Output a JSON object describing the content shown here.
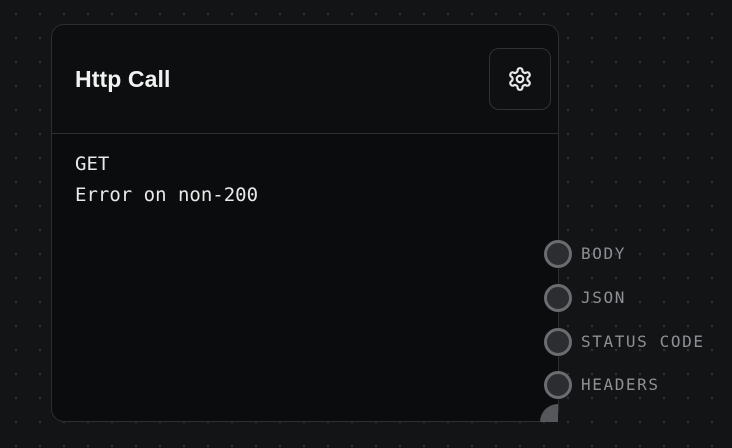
{
  "node": {
    "title": "Http Call",
    "settings_icon": "gear-icon",
    "body_lines": [
      "GET",
      "Error on non-200"
    ]
  },
  "ports": [
    {
      "label": "BODY"
    },
    {
      "label": "JSON"
    },
    {
      "label": "STATUS CODE"
    },
    {
      "label": "HEADERS"
    }
  ],
  "colors": {
    "canvas_background": "#131416",
    "node_background": "#0b0c0d",
    "border": "#2c2e31",
    "title_text": "#f2f2f2",
    "port_label": "#8d9094",
    "port_handle_border": "#6a6c70"
  }
}
